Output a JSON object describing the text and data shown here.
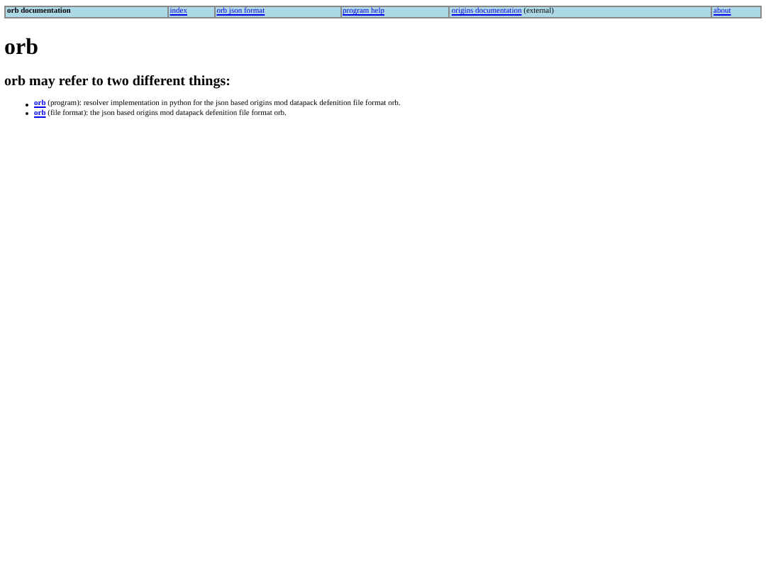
{
  "nav": [
    {
      "kind": "title",
      "label": "orb documentation"
    },
    {
      "kind": "link",
      "label": "index"
    },
    {
      "kind": "link",
      "label": "orb json format"
    },
    {
      "kind": "link",
      "label": "program help"
    },
    {
      "kind": "link",
      "label": "origins documentation",
      "note": "(external)"
    },
    {
      "kind": "link",
      "label": "about"
    }
  ],
  "title": "orb",
  "subtitle": "orb may refer to two different things:",
  "items": [
    {
      "link": "orb",
      "text": " (program): resolver implementation in python for the json based origins mod datapack defenition file format orb."
    },
    {
      "link": "orb",
      "text": " (file format): the json based origins mod datapack defenition file format orb."
    }
  ]
}
